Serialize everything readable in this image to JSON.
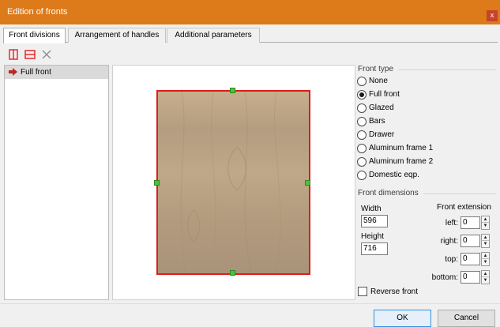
{
  "window": {
    "title": "Edition of fronts",
    "close_glyph": "x"
  },
  "tabs": [
    {
      "label": "Front divisions",
      "active": true
    },
    {
      "label": "Arrangement of handles",
      "active": false
    },
    {
      "label": "Additional parameters",
      "active": false
    }
  ],
  "toolbar": {
    "icons": [
      "split-vertical-icon",
      "split-horizontal-icon",
      "delete-icon"
    ]
  },
  "divisions": {
    "items": [
      {
        "label": "Full front",
        "selected": true
      }
    ]
  },
  "front_type": {
    "title": "Front type",
    "options": [
      {
        "label": "None",
        "checked": false
      },
      {
        "label": "Full front",
        "checked": true
      },
      {
        "label": "Glazed",
        "checked": false
      },
      {
        "label": "Bars",
        "checked": false
      },
      {
        "label": "Drawer",
        "checked": false
      },
      {
        "label": "Aluminum frame 1",
        "checked": false
      },
      {
        "label": "Aluminum frame 2",
        "checked": false
      },
      {
        "label": "Domestic eqp.",
        "checked": false
      }
    ]
  },
  "dimensions": {
    "title": "Front dimensions",
    "width_label": "Width",
    "width_value": "596",
    "height_label": "Height",
    "height_value": "716",
    "extension_title": "Front extension",
    "left_label": "left:",
    "left_value": "0",
    "right_label": "right:",
    "right_value": "0",
    "top_label": "top:",
    "top_value": "0",
    "bottom_label": "bottom:",
    "bottom_value": "0"
  },
  "reverse_front": {
    "label": "Reverse front",
    "checked": false
  },
  "buttons": {
    "ok": "OK",
    "cancel": "Cancel"
  },
  "colors": {
    "titlebar": "#dd7a1a",
    "front_border": "#e01b1b",
    "handle": "#49c43a",
    "wood": "#bea888"
  }
}
